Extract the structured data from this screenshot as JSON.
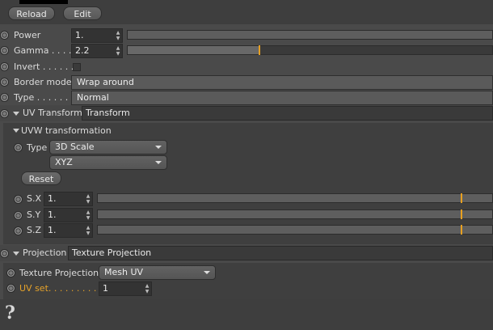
{
  "toolbar": {
    "reload_label": "Reload",
    "edit_label": "Edit"
  },
  "params": {
    "power": {
      "label": "Power",
      "value": "1."
    },
    "gamma": {
      "label": "Gamma . . . . .",
      "value": "2.2",
      "level": 0.36
    },
    "invert": {
      "label": "Invert . . . . . .",
      "checked": false
    },
    "border_mode": {
      "label": "Border mode",
      "value": "Wrap around"
    },
    "type": {
      "label": "Type . . . . . . .",
      "value": "Normal"
    }
  },
  "uv_transform": {
    "label": "UV Transform",
    "value": "Transform"
  },
  "uvw": {
    "header": "UVW transformation",
    "type_label": "Type",
    "type_value": "3D Scale",
    "axis_value": "XYZ",
    "reset_label": "Reset",
    "sx": {
      "label": "S.X",
      "value": "1.",
      "level": 0.92
    },
    "sy": {
      "label": "S.Y",
      "value": "1.",
      "level": 0.92
    },
    "sz": {
      "label": "S.Z",
      "value": "1.",
      "level": 0.92
    }
  },
  "projection": {
    "label": "Projection",
    "value": "Texture Projection"
  },
  "texproj": {
    "label": "Texture Projection",
    "value": "Mesh UV",
    "uvset_label": "UV set. . . . . . . . . .",
    "uvset_value": "1"
  },
  "help_glyph": "?",
  "colors": {
    "accent": "#e8a020",
    "background": "#4a4a4a"
  }
}
